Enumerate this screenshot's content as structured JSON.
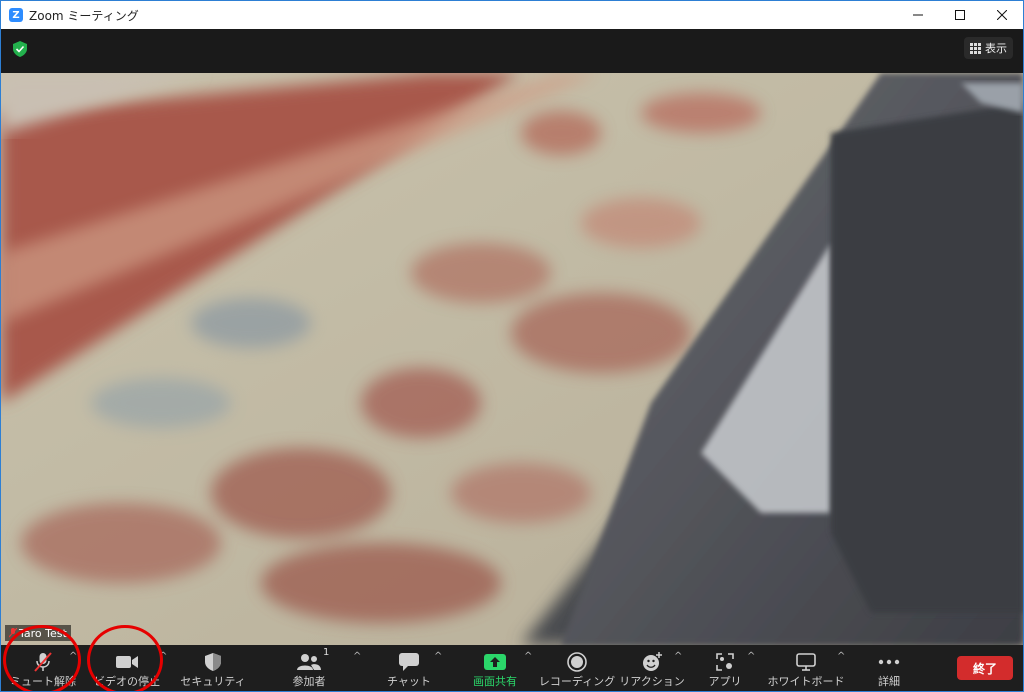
{
  "window": {
    "title": "Zoom ミーティング",
    "controls": {
      "minimize": "—",
      "maximize": "☐",
      "close": "✕"
    }
  },
  "topbar": {
    "view_label": "表示"
  },
  "participant": {
    "name": "Taro Test"
  },
  "toolbar": {
    "items": [
      {
        "label": "ミュート解除",
        "icon": "microphone-muted-icon"
      },
      {
        "label": "ビデオの停止",
        "icon": "video-camera-icon"
      },
      {
        "label": "セキュリティ",
        "icon": "shield-icon"
      },
      {
        "label": "参加者",
        "icon": "participants-icon",
        "count": "1"
      },
      {
        "label": "チャット",
        "icon": "chat-icon"
      },
      {
        "label": "画面共有",
        "icon": "share-screen-icon"
      },
      {
        "label": "レコーディング",
        "icon": "record-icon"
      },
      {
        "label": "リアクション",
        "icon": "reaction-icon"
      },
      {
        "label": "アプリ",
        "icon": "apps-icon"
      },
      {
        "label": "ホワイトボード",
        "icon": "whiteboard-icon"
      },
      {
        "label": "詳細",
        "icon": "more-icon"
      }
    ],
    "caret": "^",
    "end_label": "終了"
  },
  "colors": {
    "accent": "#2d8cff",
    "share_green": "#2bd66a",
    "end_red": "#d32c2c",
    "annotation_red": "#e60000"
  }
}
